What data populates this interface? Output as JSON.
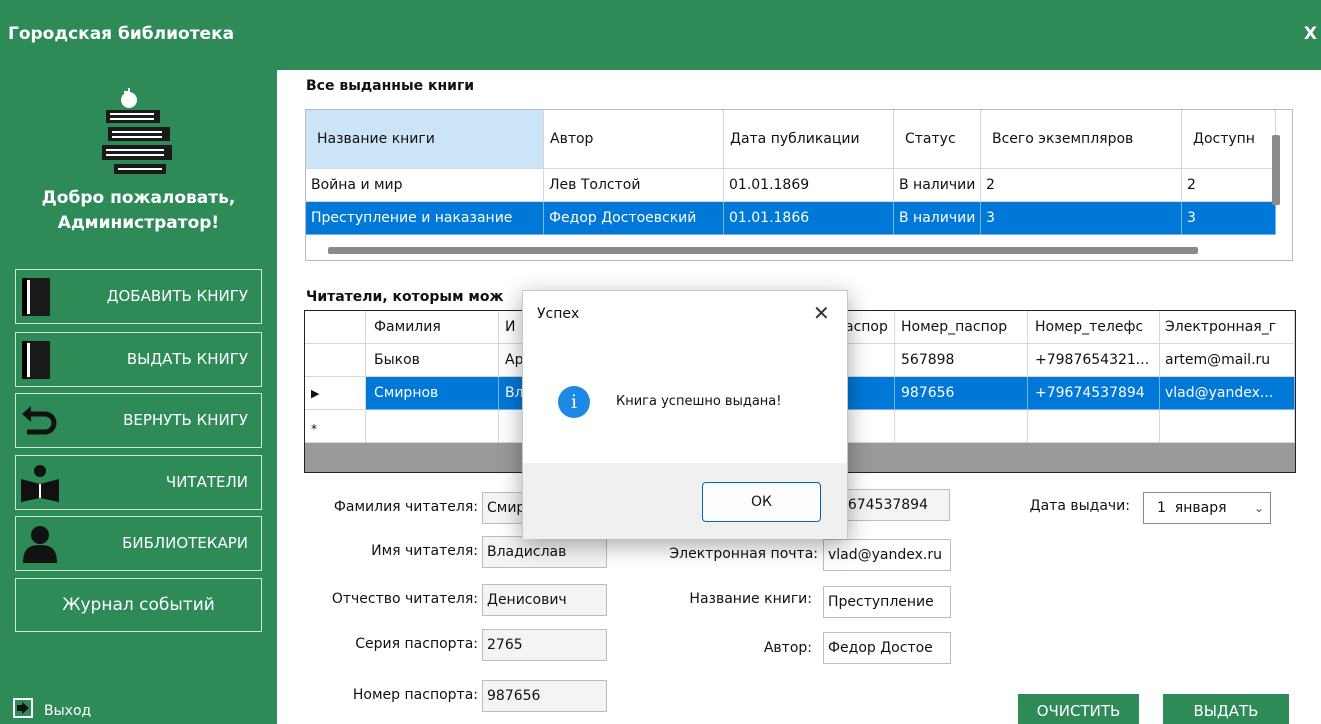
{
  "app": {
    "title": "Городская библиотека",
    "close_label": "X"
  },
  "sidebar": {
    "welcome_line1": "Добро пожаловать,",
    "welcome_line2": "Администратор!",
    "menu": [
      {
        "label": "ДОБАВИТЬ КНИГУ",
        "icon": "book-icon"
      },
      {
        "label": "ВЫДАТЬ КНИГУ",
        "icon": "book-icon"
      },
      {
        "label": "ВЕРНУТЬ КНИГУ",
        "icon": "return-arrow-icon"
      },
      {
        "label": "ЧИТАТЕЛИ",
        "icon": "reader-icon"
      },
      {
        "label": "БИБЛИОТЕКАРИ",
        "icon": "person-icon"
      }
    ],
    "journal_label": "Журнал событий",
    "exit_label": "Выход"
  },
  "books": {
    "title": "Все выданные книги",
    "columns": [
      "Название книги",
      "Автор",
      "Дата публикации",
      "Статус",
      "Всего экземпляров",
      "Доступн"
    ],
    "rows": [
      [
        "Война и мир",
        "Лев Толстой",
        "01.01.1869",
        "В наличии",
        "2",
        "2"
      ],
      [
        "Преступление и наказание",
        "Федор Достоевский",
        "01.01.1866",
        "В наличии",
        "3",
        "3"
      ]
    ]
  },
  "readers": {
    "title": "Читатели, которым мож",
    "columns": [
      "Фамилия",
      "И",
      "аспор",
      "Номер_паспор",
      "Номер_телефс",
      "Электронная_г"
    ],
    "rows": [
      [
        "Быков",
        "Ар",
        "",
        "567898",
        "+7987654321...",
        "artem@mail.ru"
      ],
      [
        "Смирнов",
        "Вл",
        "",
        "987656",
        "+79674537894",
        "vlad@yandex..."
      ]
    ],
    "current_row_marker": "▶",
    "new_row_marker": "*"
  },
  "form": {
    "surname_label": "Фамилия читателя:",
    "surname": "Смир",
    "name_label": "Имя читателя:",
    "name": "Владислав",
    "patronymic_label": "Отчество читателя:",
    "patronymic": "Денисович",
    "passport_series_label": "Серия паспорта:",
    "passport_series": "2765",
    "passport_number_label": "Номер паспорта:",
    "passport_number": "987656",
    "phone": "79674537894",
    "email_label": "Электронная почта:",
    "email": "vlad@yandex.ru",
    "book_label": "Название книги:",
    "book": "Преступление",
    "author_label": "Автор:",
    "author": "Федор Достое",
    "date_label": "Дата выдачи:",
    "date": "1  января",
    "clear_label": "ОЧИСТИТЬ",
    "issue_label": "ВЫДАТЬ"
  },
  "dialog": {
    "title": "Успех",
    "message": "Книга успешно выдана!",
    "ok_label": "ОК",
    "icon": "info-icon"
  },
  "colors": {
    "brand": "#2e8b57",
    "selection": "#0078d7",
    "header_selected": "#cce4f7"
  }
}
